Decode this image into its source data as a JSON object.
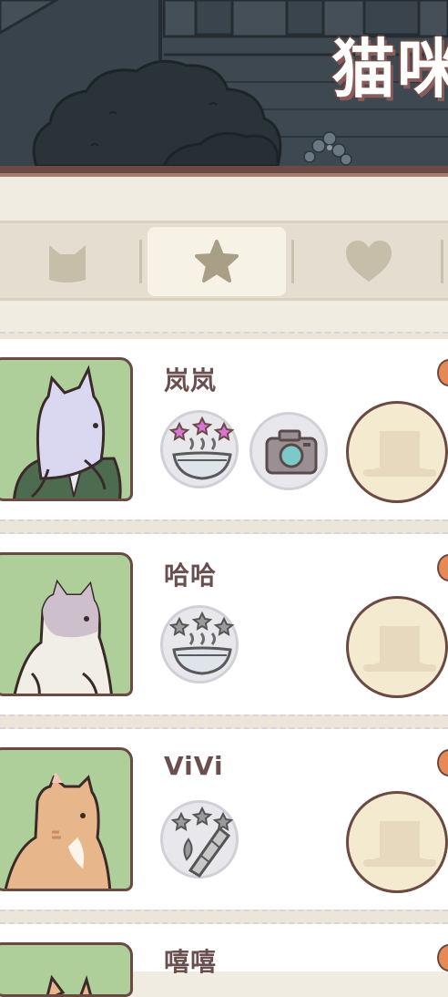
{
  "header": {
    "title": "猫咪"
  },
  "tabs": [
    {
      "name": "cat",
      "icon": "cat-head-icon",
      "active": false
    },
    {
      "name": "favorite",
      "icon": "star-icon",
      "active": true
    },
    {
      "name": "heart",
      "icon": "heart-icon",
      "active": false
    }
  ],
  "cats": [
    {
      "name": "岚岚",
      "badges": [
        "bowl-3-stars-purple-icon",
        "camera-icon"
      ],
      "hat": "top-hat-icon",
      "fur": "lavender"
    },
    {
      "name": "哈哈",
      "badges": [
        "bowl-3-stars-gray-icon"
      ],
      "hat": "top-hat-icon",
      "fur": "gray-white"
    },
    {
      "name": "ViVi",
      "badges": [
        "bamboo-3-stars-gray-icon"
      ],
      "hat": "top-hat-icon",
      "fur": "orange"
    },
    {
      "name": "嘻嘻",
      "badges": [],
      "hat": "",
      "fur": "orange"
    }
  ],
  "colors": {
    "header_bg": "#39434b",
    "brown_outline": "#6b4a43",
    "portrait_bg": "#afcf9a",
    "hat_slot_bg": "#f4ead0",
    "star_purple": "#d873d8"
  }
}
